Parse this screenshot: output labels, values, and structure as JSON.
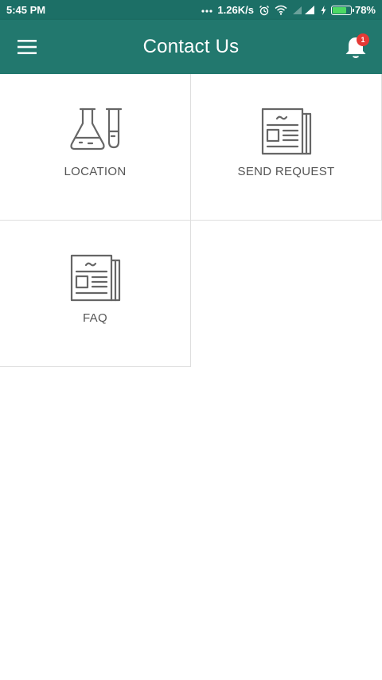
{
  "status_bar": {
    "time": "5:45 PM",
    "network_speed": "1.26K/s",
    "battery_percent": "78%",
    "battery_level": 0.78,
    "icons": [
      "dots-icon",
      "alarm-icon",
      "wifi-icon",
      "signal-icon",
      "charging-icon",
      "battery-icon"
    ]
  },
  "app_bar": {
    "title": "Contact Us",
    "menu_icon": "hamburger-menu-icon",
    "notification_icon": "bell-icon",
    "notification_count": "1"
  },
  "colors": {
    "status_bar": "#1c6f66",
    "app_bar": "#22786e",
    "badge": "#e53935",
    "icon_stroke": "#666666",
    "label": "#555555"
  },
  "tiles": [
    {
      "label": "LOCATION",
      "icon": "lab-flask-icon"
    },
    {
      "label": "SEND REQUEST",
      "icon": "newspaper-icon"
    },
    {
      "label": "FAQ",
      "icon": "newspaper-icon"
    }
  ]
}
